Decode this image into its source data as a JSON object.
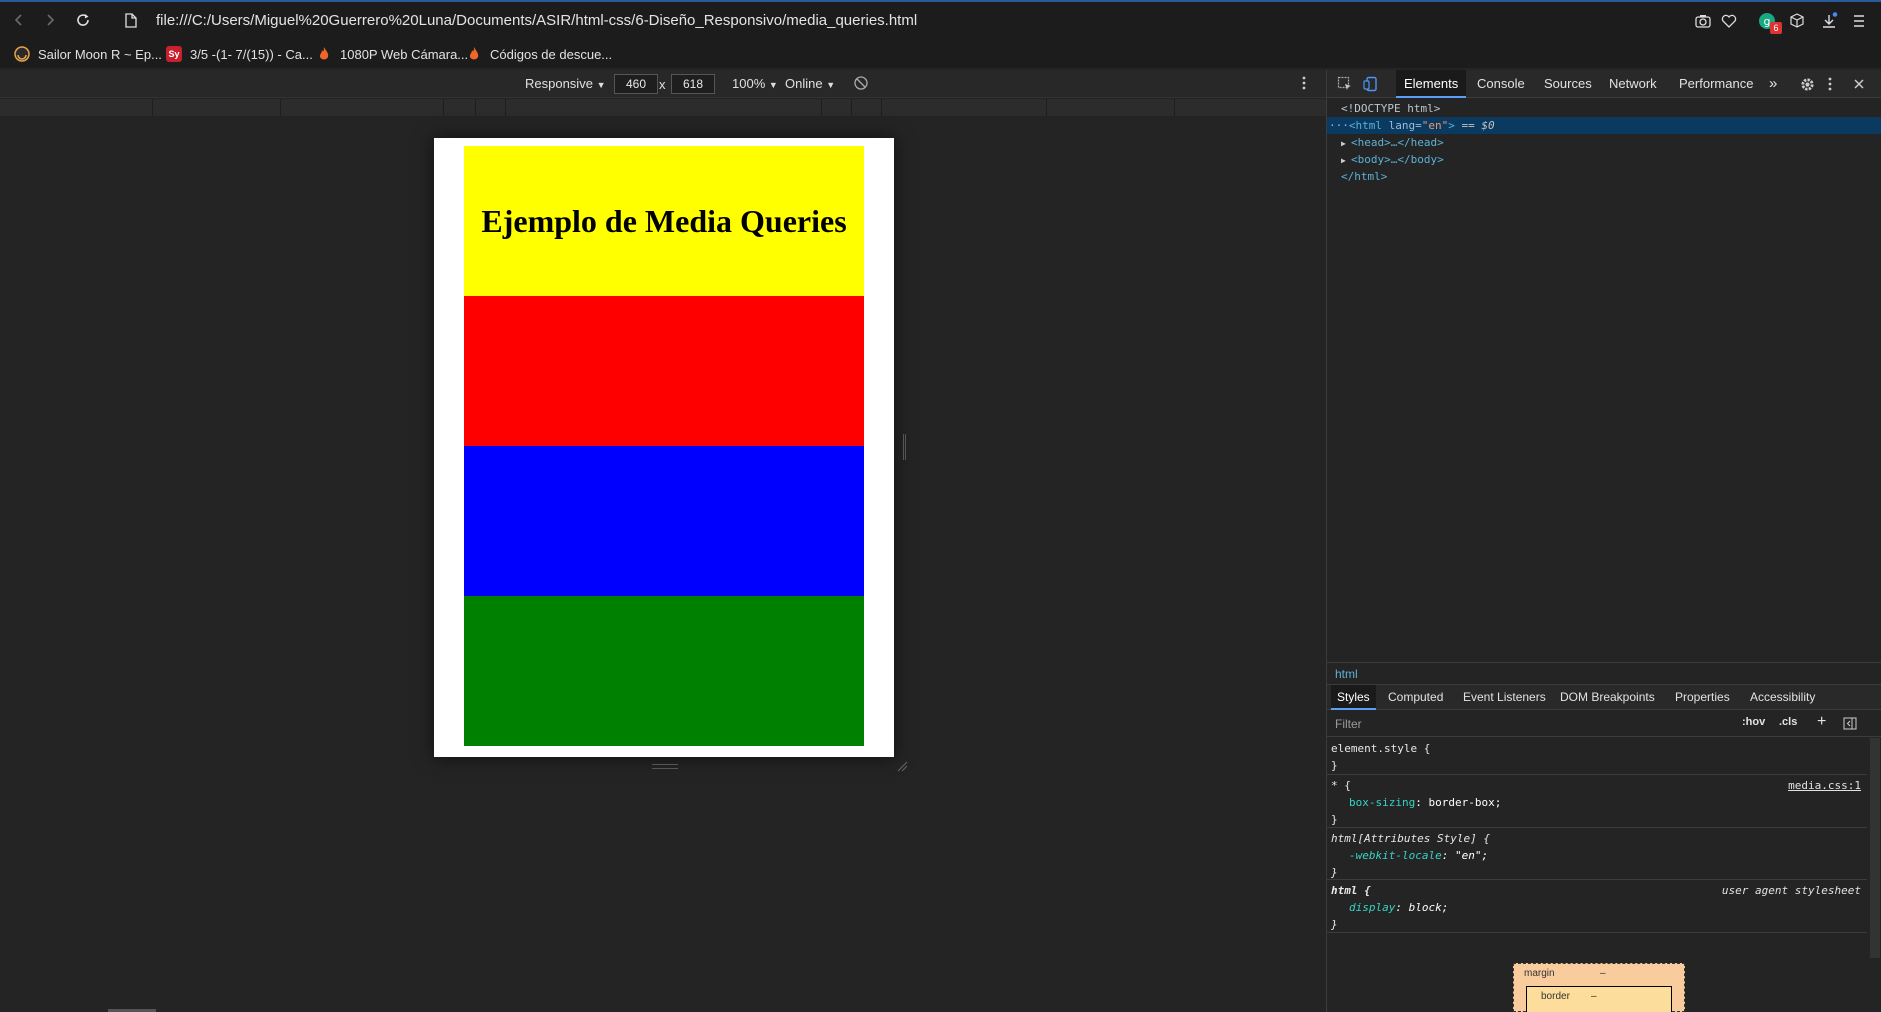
{
  "browser": {
    "url": "file:///C:/Users/Miguel%20Guerrero%20Luna/Documents/ASIR/html-css/6-Diseño_Responsivo/media_queries.html",
    "extension_badge": "6"
  },
  "bookmarks": [
    {
      "label": "Sailor Moon R ~ Ep..."
    },
    {
      "label": "3/5 -(1- 7/(15)) - Ca...",
      "favicon_text": "Sy"
    },
    {
      "label": "1080P Web Cámara..."
    },
    {
      "label": "Códigos de descue..."
    }
  ],
  "device_toolbar": {
    "mode": "Responsive",
    "width": "460",
    "height": "618",
    "times": "x",
    "zoom": "100%",
    "network": "Online"
  },
  "page": {
    "heading": "Ejemplo de Media Queries",
    "bands": [
      "#ffff00",
      "#ff0000",
      "#0000ff",
      "#008000"
    ]
  },
  "devtools": {
    "tabs": [
      "Elements",
      "Console",
      "Sources",
      "Network",
      "Performance"
    ],
    "more": "»",
    "dom": {
      "doctype": "<!DOCTYPE html>",
      "html_open_tag": "<html",
      "html_attr": "lang",
      "html_attr_value": "\"en\"",
      "html_close_bracket": ">",
      "selected_marker": "== $0",
      "head": "<head>…</head>",
      "body": "<body>…</body>",
      "html_close": "</html>"
    },
    "breadcrumb": "html",
    "subtabs": [
      "Styles",
      "Computed",
      "Event Listeners",
      "DOM Breakpoints",
      "Properties",
      "Accessibility"
    ],
    "filter_placeholder": "Filter",
    "filter_tools": {
      "hov": ":hov",
      "cls": ".cls",
      "plus": "+"
    },
    "rules": [
      {
        "selector": "element.style {",
        "source": "",
        "props": [],
        "close": "}"
      },
      {
        "selector": "* {",
        "source": "media.css:1",
        "props": [
          {
            "name": "box-sizing",
            "value": "border-box;"
          }
        ],
        "close": "}"
      },
      {
        "selector": "html[Attributes Style] {",
        "source": "",
        "props": [
          {
            "name": "-webkit-locale",
            "value": "\"en\";"
          }
        ],
        "close": "}"
      },
      {
        "selector": "html {",
        "source": "user agent stylesheet",
        "props": [
          {
            "name": "display",
            "value": "block;"
          }
        ],
        "close": "}"
      }
    ],
    "box_model": {
      "margin_label": "margin",
      "margin_value": "–",
      "border_label": "border",
      "border_value": "–"
    }
  }
}
